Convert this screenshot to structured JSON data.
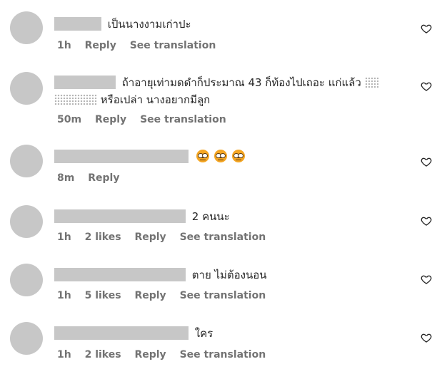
{
  "comments": [
    {
      "text": "เป็นนางงามเก่าปะ",
      "time": "1h",
      "likes": "",
      "reply": "Reply",
      "translate": "See translation"
    },
    {
      "text_line1": "ถ้าอายุเท่ามดดำก็ประมาณ 43 ก็ท้องไปเถอะ แก่แล้ว",
      "text_line2": "หรือเปล่า นางอยากมีลูก",
      "time": "50m",
      "likes": "",
      "reply": "Reply",
      "translate": "See translation"
    },
    {
      "emoji_count": 3,
      "emoji_name": "grimacing-face-emoji",
      "time": "8m",
      "likes": "",
      "reply": "Reply",
      "translate": ""
    },
    {
      "text": "2 คนนะ",
      "time": "1h",
      "likes": "2 likes",
      "reply": "Reply",
      "translate": "See translation"
    },
    {
      "text": "ตาย ไม่ต้องนอน",
      "time": "1h",
      "likes": "5 likes",
      "reply": "Reply",
      "translate": "See translation"
    },
    {
      "text": "ใคร",
      "time": "1h",
      "likes": "2 likes",
      "reply": "Reply",
      "translate": "See translation"
    }
  ],
  "icons": {
    "like": "heart-outline-icon",
    "avatar": "avatar-placeholder"
  },
  "colors": {
    "meta_text": "#737373",
    "placeholder": "#c7c7c7",
    "body_text": "#262626"
  }
}
